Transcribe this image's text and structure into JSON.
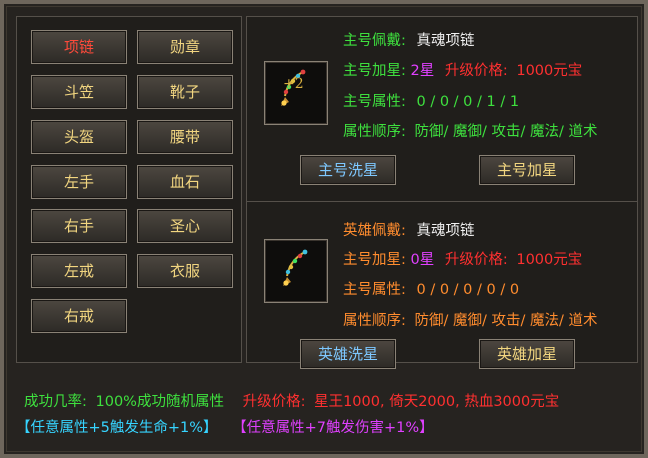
{
  "slots": [
    {
      "label": "项链",
      "active": true
    },
    {
      "label": "勋章",
      "active": false
    },
    {
      "label": "斗笠",
      "active": false
    },
    {
      "label": "靴子",
      "active": false
    },
    {
      "label": "头盔",
      "active": false
    },
    {
      "label": "腰带",
      "active": false
    },
    {
      "label": "左手",
      "active": false
    },
    {
      "label": "血石",
      "active": false
    },
    {
      "label": "右手",
      "active": false
    },
    {
      "label": "圣心",
      "active": false
    },
    {
      "label": "左戒",
      "active": false
    },
    {
      "label": "衣服",
      "active": false
    },
    {
      "label": "右戒",
      "active": false
    }
  ],
  "main": {
    "worn_label": "主号佩戴:",
    "worn_value": "真魂项链",
    "star_label": "主号加星:",
    "star_value": "2星",
    "price_label": "升级价格:",
    "price_value": "1000元宝",
    "attr_label": "主号属性:",
    "attr_value": "0 / 0 / 0 / 1 / 1",
    "order_label": "属性顺序:",
    "order_value": "防御/ 魔御/ 攻击/ 魔法/ 道术",
    "item_plus": "+2",
    "wash_button": "主号洗星",
    "star_button": "主号加星"
  },
  "hero": {
    "worn_label": "英雄佩戴:",
    "worn_value": "真魂项链",
    "star_label": "主号加星:",
    "star_value": "0星",
    "price_label": "升级价格:",
    "price_value": "1000元宝",
    "attr_label": "主号属性:",
    "attr_value": "0 / 0 / 0 / 0 / 0",
    "order_label": "属性顺序:",
    "order_value": "防御/ 魔御/ 攻击/ 魔法/ 道术",
    "wash_button": "英雄洗星",
    "star_button": "英雄加星"
  },
  "footer": {
    "success_label": "成功几率:",
    "success_value": "100%成功随机属性",
    "price_label": "升级价格:",
    "price_value": "星王1000, 倚天2000, 热血3000元宝",
    "bonus_1": "【任意属性+5触发生命+1%】",
    "bonus_2": "【任意属性+7触发伤害+1%】"
  },
  "colors": {
    "green": "#3ee03e",
    "orange": "#ff8c2e",
    "red": "#ff3030",
    "magenta": "#e040ff",
    "cyan": "#36d4ff",
    "gold": "#f2d680"
  }
}
